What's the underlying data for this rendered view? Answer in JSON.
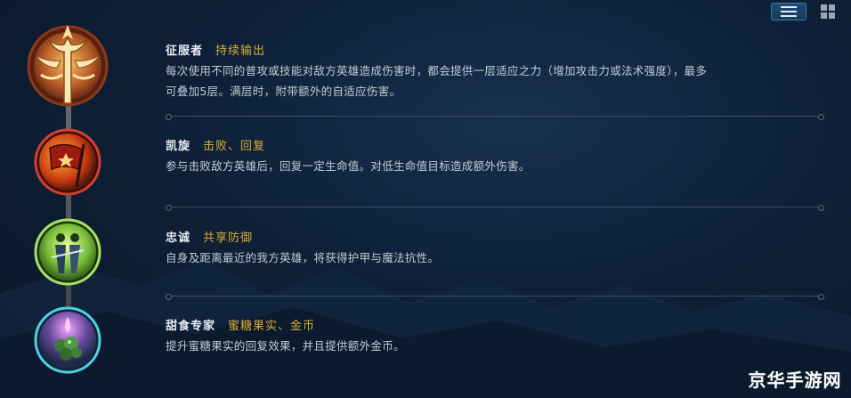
{
  "view_toggle": {
    "list_icon": "list-view-icon",
    "grid_icon": "grid-view-icon",
    "active": "list"
  },
  "runes": [
    {
      "name": "征服者",
      "tag": "持续输出",
      "desc_lines": [
        "每次使用不同的普攻或技能对敌方英雄造成伤害时，都会提供一层适应之力（增加攻击力或法术强度），最多",
        "可叠加5层。满层时，附带额外的自适应伤害。"
      ],
      "icon": "conqueror-trident-icon"
    },
    {
      "name": "凯旋",
      "tag": "击败、回复",
      "desc_lines": [
        "参与击败敌方英雄后，回复一定生命值。对低生命值目标造成额外伤害。"
      ],
      "icon": "triumph-flag-icon"
    },
    {
      "name": "忠诚",
      "tag": "共享防御",
      "desc_lines": [
        "自身及距离最近的我方英雄，将获得护甲与魔法抗性。"
      ],
      "icon": "loyalty-allies-icon"
    },
    {
      "name": "甜食专家",
      "tag": "蜜糖果实、金币",
      "desc_lines": [
        "提升蜜糖果实的回复效果，并且提供额外金币。"
      ],
      "icon": "sweet-tooth-fruit-icon"
    }
  ],
  "watermark": "京华手游网",
  "colors": {
    "tag": "#d9ad33",
    "name": "#e9eef4",
    "background": "#0e2038"
  }
}
